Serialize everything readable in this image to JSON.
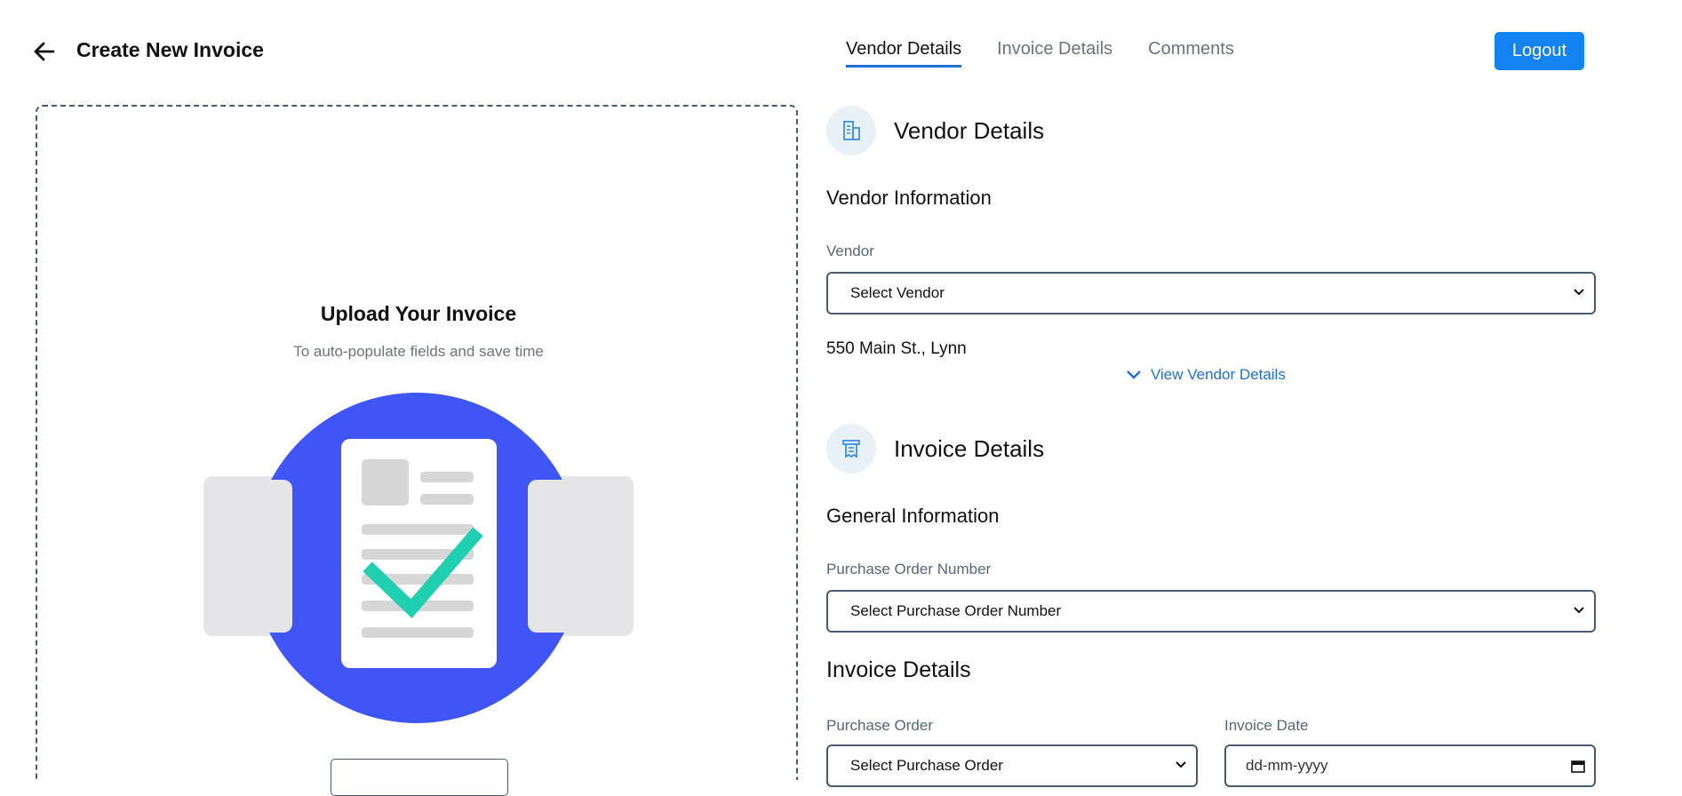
{
  "header": {
    "title": "Create New Invoice",
    "tabs": [
      {
        "label": "Vendor Details",
        "active": true
      },
      {
        "label": "Invoice Details",
        "active": false
      },
      {
        "label": "Comments",
        "active": false
      }
    ],
    "logout_label": "Logout"
  },
  "upload": {
    "title": "Upload Your Invoice",
    "subtitle": "To auto-populate fields and save time"
  },
  "vendor_section": {
    "title": "Vendor Details",
    "subtitle": "Vendor Information",
    "vendor_label": "Vendor",
    "vendor_value": "Select Vendor",
    "address": "550 Main St., Lynn",
    "view_link": "View Vendor Details"
  },
  "invoice_section": {
    "title": "Invoice Details",
    "general_title": "General Information",
    "po_number_label": "Purchase Order Number",
    "po_number_value": "Select Purchase Order Number",
    "details_title": "Invoice Details",
    "po_label": "Purchase Order",
    "po_value": "Select Purchase Order",
    "date_label": "Invoice Date",
    "date_placeholder": "dd-mm-yyyy"
  },
  "colors": {
    "primary": "#1283f0",
    "link": "#1e6fd9",
    "illustration_circle": "#3f55f5",
    "checkmark": "#1fcfb0"
  }
}
